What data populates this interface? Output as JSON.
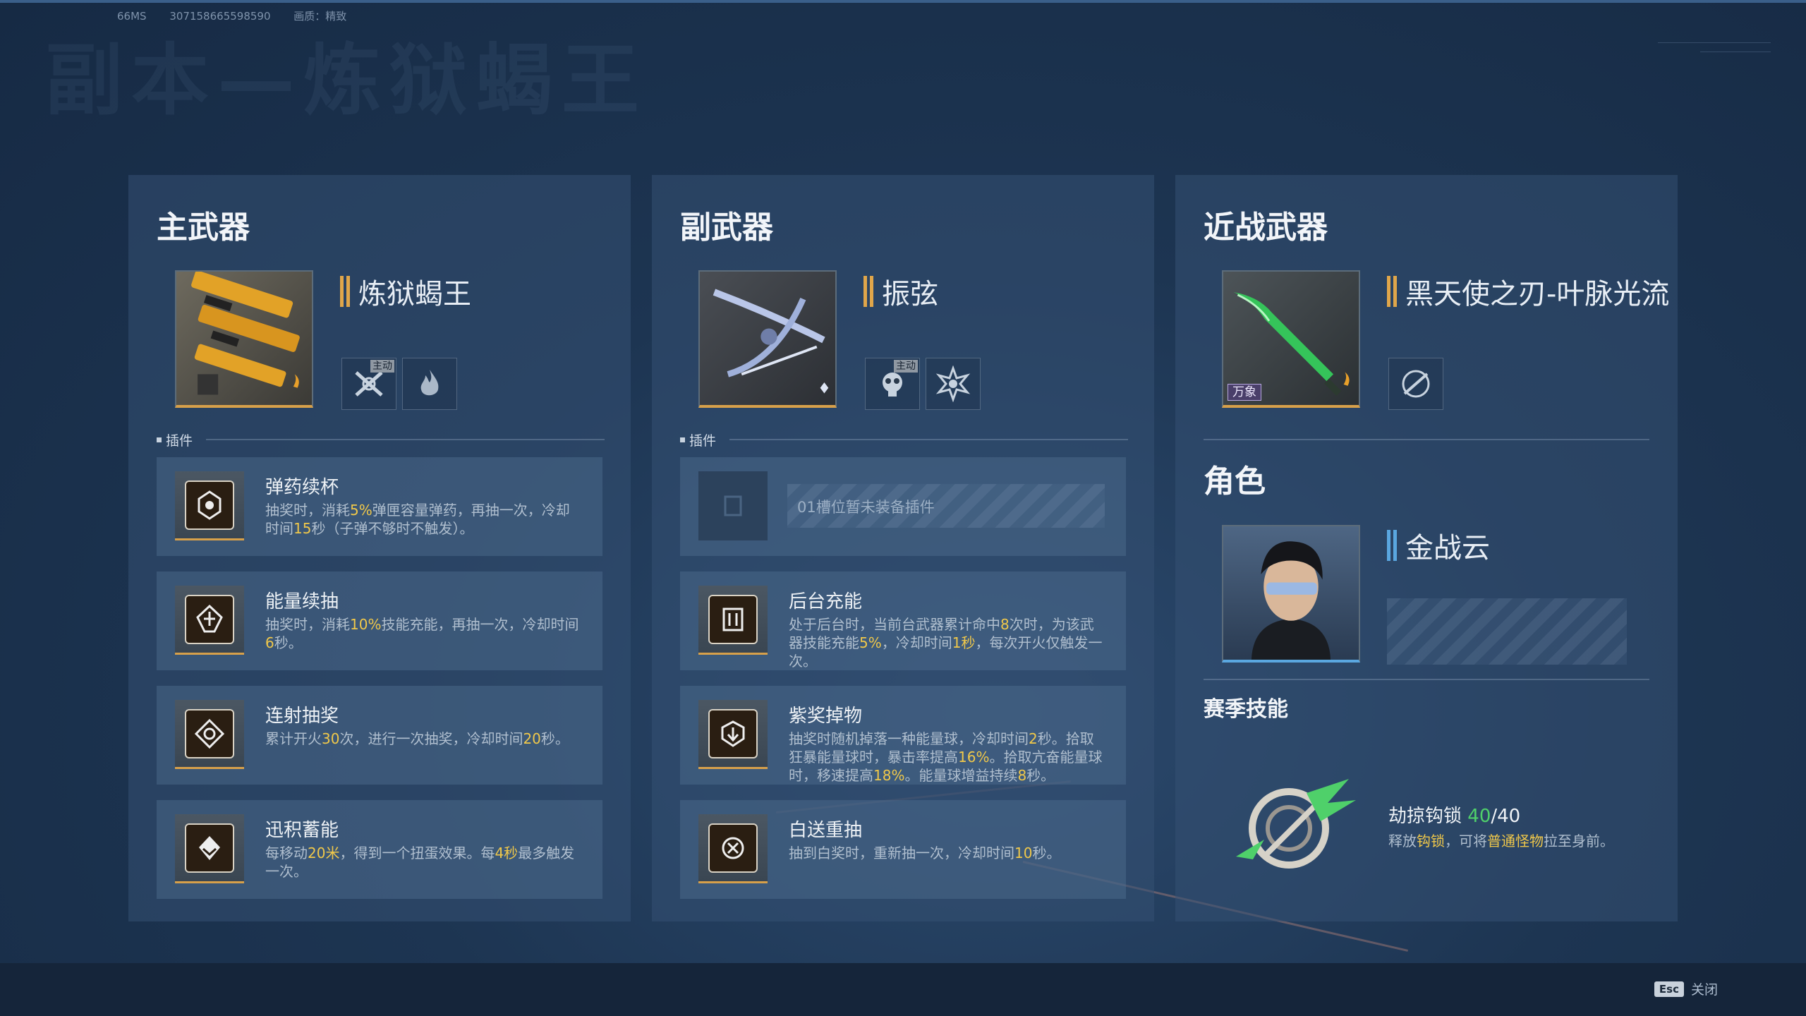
{
  "stats": {
    "latency": "66MS",
    "id": "307158665598590",
    "quality": "画质：精致"
  },
  "background_title": "副本—炼狱蝎王",
  "primary": {
    "title": "主武器",
    "weapon_name": "炼狱蝎王",
    "badge_tag": "主动",
    "section_label": "插件",
    "mods": [
      {
        "name": "弹药续杯",
        "desc": [
          "抽奖时，消耗",
          "5%",
          "弹匣容量弹药，再抽一次，冷却时间",
          "15",
          "秒（子弹不够时不触发）。"
        ]
      },
      {
        "name": "能量续抽",
        "desc": [
          "抽奖时，消耗",
          "10%",
          "技能充能，再抽一次，冷却时间",
          "6",
          "秒。"
        ]
      },
      {
        "name": "连射抽奖",
        "desc": [
          "累计开火",
          "30",
          "次，进行一次抽奖，冷却时间",
          "20",
          "秒。"
        ]
      },
      {
        "name": "迅积蓄能",
        "desc": [
          "每移动",
          "20米",
          "，得到一个扭蛋效果。每",
          "4秒",
          "最多触发一次。"
        ]
      }
    ]
  },
  "secondary": {
    "title": "副武器",
    "weapon_name": "振弦",
    "badge_tag": "主动",
    "section_label": "插件",
    "empty_slot": "01槽位暂未装备插件",
    "mods": [
      {
        "name": "后台充能",
        "desc": [
          "处于后台时，当前台武器累计命中",
          "8",
          "次时，为该武器技能充能",
          "5%",
          "，冷却时间",
          "1秒",
          "，每次开火仅触发一次。"
        ]
      },
      {
        "name": "紫奖掉物",
        "desc": [
          "抽奖时随机掉落一种能量球，冷却时间",
          "2",
          "秒。拾取狂暴能量球时，暴击率提高",
          "16%",
          "。拾取亢奋能量球时，移速提高",
          "18%",
          "。能量球增益持续",
          "8",
          "秒。"
        ]
      },
      {
        "name": "白送重抽",
        "desc": [
          "抽到白奖时，重新抽一次，冷却时间",
          "10",
          "秒。"
        ]
      }
    ]
  },
  "melee": {
    "title": "近战武器",
    "weapon_name": "黑天使之刃-叶脉光流",
    "weapon_tag": "万象",
    "character_title": "角色",
    "character_name": "金战云",
    "season_skill_title": "赛季技能",
    "skill": {
      "name": "劫掠钩锁",
      "level": "40",
      "max": "/40",
      "desc": [
        "释放",
        "钩锁",
        "，可将",
        "普通怪物",
        "拉至身前。"
      ]
    }
  },
  "footer": {
    "esc_key": "Esc",
    "close_label": "关闭"
  },
  "colors": {
    "accent_gold": "#f0c84a",
    "accent_green": "#4fd06a",
    "bar_gold": "#e0a64a",
    "bar_blue": "#5aa7e0"
  },
  "icons": [
    "weapon-scorpion-image",
    "weapon-bow-image",
    "weapon-blade-image",
    "character-portrait",
    "skill-hook-icon"
  ]
}
